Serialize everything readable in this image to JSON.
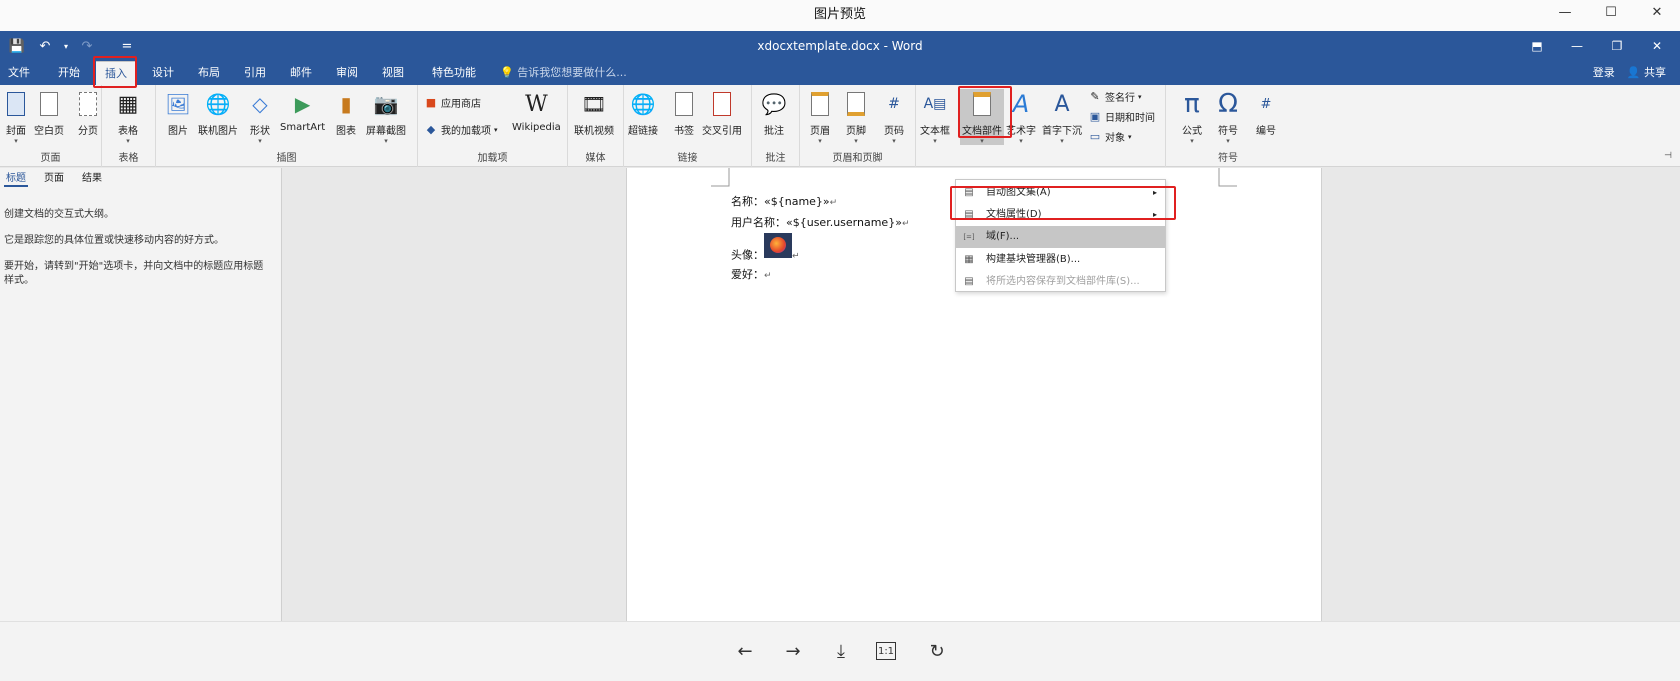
{
  "viewer": {
    "title": "图片预览",
    "controls": [
      "—",
      "☐",
      "✕"
    ],
    "bottom_controls": [
      "←",
      "→",
      "⤓",
      "1:1",
      "↻"
    ]
  },
  "word": {
    "qat": [
      "💾",
      "↶",
      "▾",
      "↷",
      "="
    ],
    "doc_title": "xdocxtemplate.docx - Word",
    "title_right": [
      "⬒",
      "—",
      "❐",
      "✕"
    ],
    "tabs": [
      "文件",
      "开始",
      "插入",
      "设计",
      "布局",
      "引用",
      "邮件",
      "审阅",
      "视图",
      "特色功能"
    ],
    "active_tab": "插入",
    "tell_me": "告诉我您想要做什么...",
    "signin": "登录",
    "share": "共享"
  },
  "ribbon": {
    "groups": {
      "pages": "页面",
      "tables": "表格",
      "illustrations": "插图",
      "addins": "加载项",
      "media": "媒体",
      "links": "链接",
      "comments": "批注",
      "header_footer": "页眉和页脚",
      "symbols": "符号"
    },
    "buttons": {
      "cover": "封面",
      "blank": "空白页",
      "break": "分页",
      "table": "表格",
      "picture": "图片",
      "online_picture": "联机图片",
      "shapes": "形状",
      "smartart": "SmartArt",
      "chart": "图表",
      "screenshot": "屏幕截图",
      "store": "应用商店",
      "my_addins": "我的加载项",
      "wikipedia": "Wikipedia",
      "online_video": "联机视频",
      "hyperlink": "超链接",
      "bookmark": "书签",
      "cross_ref": "交叉引用",
      "comment": "批注",
      "header": "页眉",
      "footer": "页脚",
      "page_number": "页码",
      "textbox": "文本框",
      "quick_parts": "文档部件",
      "wordart": "艺术字",
      "dropcap": "首字下沉",
      "signature": "签名行",
      "datetime": "日期和时间",
      "object": "对象",
      "equation": "公式",
      "symbol": "符号",
      "numbering": "编号"
    }
  },
  "nav": {
    "tabs": [
      "标题",
      "页面",
      "结果"
    ],
    "p1": "创建文档的交互式大纲。",
    "p2": "它是跟踪您的具体位置或快速移动内容的好方式。",
    "p3": "要开始，请转到\"开始\"选项卡，并向文档中的标题应用标题样式。"
  },
  "document": {
    "line1_label": "名称：",
    "line1_field": "«${name}»",
    "line2_label": "用户名称：",
    "line2_field": "«${user.username}»",
    "line3_label": "头像：",
    "line4_label": "爱好：",
    "para_mark": "↵"
  },
  "menu": {
    "items": [
      {
        "label": "自动图文集(A)",
        "icon": "▤",
        "arrow": "▸"
      },
      {
        "label": "文档属性(D)",
        "icon": "▤",
        "arrow": "▸"
      },
      {
        "label": "域(F)...",
        "icon": "[=]",
        "arrow": ""
      },
      {
        "label": "构建基块管理器(B)...",
        "icon": "▦",
        "arrow": ""
      },
      {
        "label": "将所选内容保存到文档部件库(S)...",
        "icon": "▤",
        "arrow": ""
      }
    ]
  },
  "colors": {
    "word_blue": "#2b579a",
    "highlight_red": "#e02020"
  }
}
